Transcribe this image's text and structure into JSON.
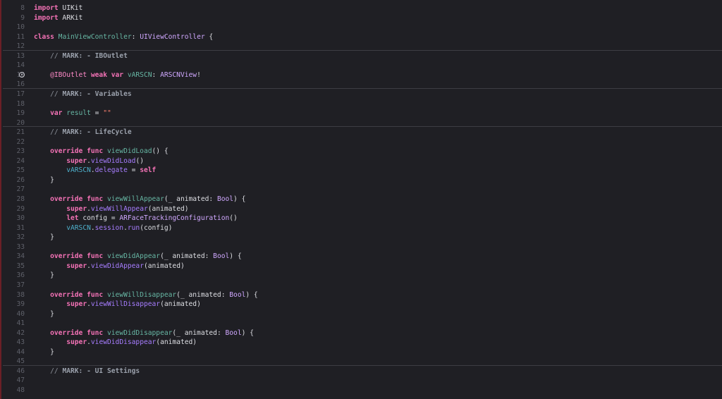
{
  "editor": {
    "lines": [
      {
        "n": "8",
        "tokens": [
          {
            "t": "import",
            "c": "kw"
          },
          {
            "t": " UIKit",
            "c": "pl"
          }
        ]
      },
      {
        "n": "9",
        "tokens": [
          {
            "t": "import",
            "c": "kw"
          },
          {
            "t": " ARKit",
            "c": "pl"
          }
        ]
      },
      {
        "n": "10",
        "tokens": []
      },
      {
        "n": "11",
        "tokens": [
          {
            "t": "class",
            "c": "kw"
          },
          {
            "t": " MainViewController",
            "c": "fn"
          },
          {
            "t": ": ",
            "c": "pl"
          },
          {
            "t": "UIViewController",
            "c": "ty"
          },
          {
            "t": " {",
            "c": "pl"
          }
        ]
      },
      {
        "n": "12",
        "tokens": []
      },
      {
        "n": "13",
        "sep": true,
        "tokens": [
          {
            "t": "    // ",
            "c": "cm"
          },
          {
            "t": "MARK: - IBOutlet",
            "c": "mk"
          }
        ]
      },
      {
        "n": "14",
        "tokens": []
      },
      {
        "n": "15",
        "marker": true,
        "tokens": [
          {
            "t": "    ",
            "c": "pl"
          },
          {
            "t": "@IBOutlet",
            "c": "attr"
          },
          {
            "t": " weak var",
            "c": "kw"
          },
          {
            "t": " vARSCN",
            "c": "fn"
          },
          {
            "t": ": ",
            "c": "pl"
          },
          {
            "t": "ARSCNView",
            "c": "ty"
          },
          {
            "t": "!",
            "c": "pl"
          }
        ]
      },
      {
        "n": "16",
        "tokens": []
      },
      {
        "n": "17",
        "sep": true,
        "tokens": [
          {
            "t": "    // ",
            "c": "cm"
          },
          {
            "t": "MARK: - Variables",
            "c": "mk"
          }
        ]
      },
      {
        "n": "18",
        "tokens": []
      },
      {
        "n": "19",
        "tokens": [
          {
            "t": "    ",
            "c": "pl"
          },
          {
            "t": "var",
            "c": "kw"
          },
          {
            "t": " result",
            "c": "fn"
          },
          {
            "t": " = ",
            "c": "pl"
          },
          {
            "t": "\"\"",
            "c": "str"
          }
        ]
      },
      {
        "n": "20",
        "tokens": []
      },
      {
        "n": "21",
        "sep": true,
        "tokens": [
          {
            "t": "    // ",
            "c": "cm"
          },
          {
            "t": "MARK: - LifeCycle",
            "c": "mk"
          }
        ]
      },
      {
        "n": "22",
        "tokens": []
      },
      {
        "n": "23",
        "tokens": [
          {
            "t": "    ",
            "c": "pl"
          },
          {
            "t": "override func",
            "c": "kw"
          },
          {
            "t": " viewDidLoad",
            "c": "fn"
          },
          {
            "t": "() {",
            "c": "pl"
          }
        ]
      },
      {
        "n": "24",
        "tokens": [
          {
            "t": "        ",
            "c": "pl"
          },
          {
            "t": "super",
            "c": "kw"
          },
          {
            "t": ".",
            "c": "pl"
          },
          {
            "t": "viewDidLoad",
            "c": "mth"
          },
          {
            "t": "()",
            "c": "pl"
          }
        ]
      },
      {
        "n": "25",
        "tokens": [
          {
            "t": "        ",
            "c": "pl"
          },
          {
            "t": "vARSCN",
            "c": "prop"
          },
          {
            "t": ".",
            "c": "pl"
          },
          {
            "t": "delegate",
            "c": "mth"
          },
          {
            "t": " = ",
            "c": "pl"
          },
          {
            "t": "self",
            "c": "kw"
          }
        ]
      },
      {
        "n": "26",
        "tokens": [
          {
            "t": "    }",
            "c": "pl"
          }
        ]
      },
      {
        "n": "27",
        "tokens": []
      },
      {
        "n": "28",
        "tokens": [
          {
            "t": "    ",
            "c": "pl"
          },
          {
            "t": "override func",
            "c": "kw"
          },
          {
            "t": " viewWillAppear",
            "c": "fn"
          },
          {
            "t": "(_ animated: ",
            "c": "pl"
          },
          {
            "t": "Bool",
            "c": "ty"
          },
          {
            "t": ") {",
            "c": "pl"
          }
        ]
      },
      {
        "n": "29",
        "tokens": [
          {
            "t": "        ",
            "c": "pl"
          },
          {
            "t": "super",
            "c": "kw"
          },
          {
            "t": ".",
            "c": "pl"
          },
          {
            "t": "viewWillAppear",
            "c": "mth"
          },
          {
            "t": "(animated)",
            "c": "pl"
          }
        ]
      },
      {
        "n": "30",
        "tokens": [
          {
            "t": "        ",
            "c": "pl"
          },
          {
            "t": "let",
            "c": "kw"
          },
          {
            "t": " config = ",
            "c": "pl"
          },
          {
            "t": "ARFaceTrackingConfiguration",
            "c": "ty"
          },
          {
            "t": "()",
            "c": "pl"
          }
        ]
      },
      {
        "n": "31",
        "tokens": [
          {
            "t": "        ",
            "c": "pl"
          },
          {
            "t": "vARSCN",
            "c": "prop"
          },
          {
            "t": ".",
            "c": "pl"
          },
          {
            "t": "session",
            "c": "mth"
          },
          {
            "t": ".",
            "c": "pl"
          },
          {
            "t": "run",
            "c": "mth"
          },
          {
            "t": "(config)",
            "c": "pl"
          }
        ]
      },
      {
        "n": "32",
        "tokens": [
          {
            "t": "    }",
            "c": "pl"
          }
        ]
      },
      {
        "n": "33",
        "tokens": []
      },
      {
        "n": "34",
        "tokens": [
          {
            "t": "    ",
            "c": "pl"
          },
          {
            "t": "override func",
            "c": "kw"
          },
          {
            "t": " viewDidAppear",
            "c": "fn"
          },
          {
            "t": "(_ animated: ",
            "c": "pl"
          },
          {
            "t": "Bool",
            "c": "ty"
          },
          {
            "t": ") {",
            "c": "pl"
          }
        ]
      },
      {
        "n": "35",
        "tokens": [
          {
            "t": "        ",
            "c": "pl"
          },
          {
            "t": "super",
            "c": "kw"
          },
          {
            "t": ".",
            "c": "pl"
          },
          {
            "t": "viewDidAppear",
            "c": "mth"
          },
          {
            "t": "(animated)",
            "c": "pl"
          }
        ]
      },
      {
        "n": "36",
        "tokens": [
          {
            "t": "    }",
            "c": "pl"
          }
        ]
      },
      {
        "n": "37",
        "tokens": []
      },
      {
        "n": "38",
        "tokens": [
          {
            "t": "    ",
            "c": "pl"
          },
          {
            "t": "override func",
            "c": "kw"
          },
          {
            "t": " viewWillDisappear",
            "c": "fn"
          },
          {
            "t": "(_ animated: ",
            "c": "pl"
          },
          {
            "t": "Bool",
            "c": "ty"
          },
          {
            "t": ") {",
            "c": "pl"
          }
        ]
      },
      {
        "n": "39",
        "tokens": [
          {
            "t": "        ",
            "c": "pl"
          },
          {
            "t": "super",
            "c": "kw"
          },
          {
            "t": ".",
            "c": "pl"
          },
          {
            "t": "viewWillDisappear",
            "c": "mth"
          },
          {
            "t": "(animated)",
            "c": "pl"
          }
        ]
      },
      {
        "n": "40",
        "tokens": [
          {
            "t": "    }",
            "c": "pl"
          }
        ]
      },
      {
        "n": "41",
        "tokens": []
      },
      {
        "n": "42",
        "tokens": [
          {
            "t": "    ",
            "c": "pl"
          },
          {
            "t": "override func",
            "c": "kw"
          },
          {
            "t": " viewDidDisappear",
            "c": "fn"
          },
          {
            "t": "(_ animated: ",
            "c": "pl"
          },
          {
            "t": "Bool",
            "c": "ty"
          },
          {
            "t": ") {",
            "c": "pl"
          }
        ]
      },
      {
        "n": "43",
        "tokens": [
          {
            "t": "        ",
            "c": "pl"
          },
          {
            "t": "super",
            "c": "kw"
          },
          {
            "t": ".",
            "c": "pl"
          },
          {
            "t": "viewDidDisappear",
            "c": "mth"
          },
          {
            "t": "(animated)",
            "c": "pl"
          }
        ]
      },
      {
        "n": "44",
        "tokens": [
          {
            "t": "    }",
            "c": "pl"
          }
        ]
      },
      {
        "n": "45",
        "tokens": []
      },
      {
        "n": "46",
        "sep": true,
        "tokens": [
          {
            "t": "    // ",
            "c": "cm"
          },
          {
            "t": "MARK: - UI Settings",
            "c": "mk"
          }
        ]
      },
      {
        "n": "47",
        "tokens": []
      },
      {
        "n": "48",
        "tokens": []
      }
    ]
  }
}
